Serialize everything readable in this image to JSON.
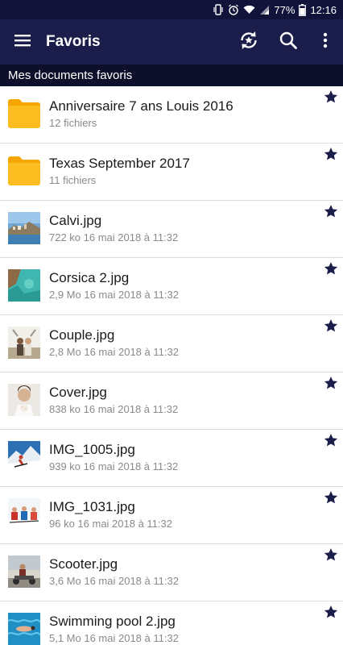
{
  "status": {
    "battery": "77%",
    "time": "12:16"
  },
  "appbar": {
    "title": "Favoris"
  },
  "section": {
    "title": "Mes documents favoris"
  },
  "colors": {
    "appbar": "#1b1e4a",
    "statusbar": "#11133a",
    "folder": "#f9b91a",
    "star": "#1b1e4a"
  },
  "items": [
    {
      "title": "Anniversaire 7 ans Louis 2016",
      "sub": "12 fichiers",
      "type": "folder"
    },
    {
      "title": "Texas September 2017",
      "sub": "11 fichiers",
      "type": "folder"
    },
    {
      "title": "Calvi.jpg",
      "sub": "722 ko 16 mai 2018 à 11:32",
      "type": "image",
      "icon": "coastal-town-photo"
    },
    {
      "title": "Corsica 2.jpg",
      "sub": "2,9 Mo 16 mai 2018 à 11:32",
      "type": "image",
      "icon": "turquoise-sea-photo"
    },
    {
      "title": "Couple.jpg",
      "sub": "2,8 Mo 16 mai 2018 à 11:32",
      "type": "image",
      "icon": "couple-photo"
    },
    {
      "title": "Cover.jpg",
      "sub": "838 ko 16 mai 2018 à 11:32",
      "type": "image",
      "icon": "bride-photo"
    },
    {
      "title": "IMG_1005.jpg",
      "sub": "939 ko 16 mai 2018 à 11:32",
      "type": "image",
      "icon": "skier-photo"
    },
    {
      "title": "IMG_1031.jpg",
      "sub": "96 ko 16 mai 2018 à 11:32",
      "type": "image",
      "icon": "ski-group-photo"
    },
    {
      "title": "Scooter.jpg",
      "sub": "3,6 Mo 16 mai 2018 à 11:32",
      "type": "image",
      "icon": "scooter-photo"
    },
    {
      "title": "Swimming pool 2.jpg",
      "sub": "5,1 Mo 16 mai 2018 à 11:32",
      "type": "image",
      "icon": "swimming-pool-photo"
    }
  ]
}
